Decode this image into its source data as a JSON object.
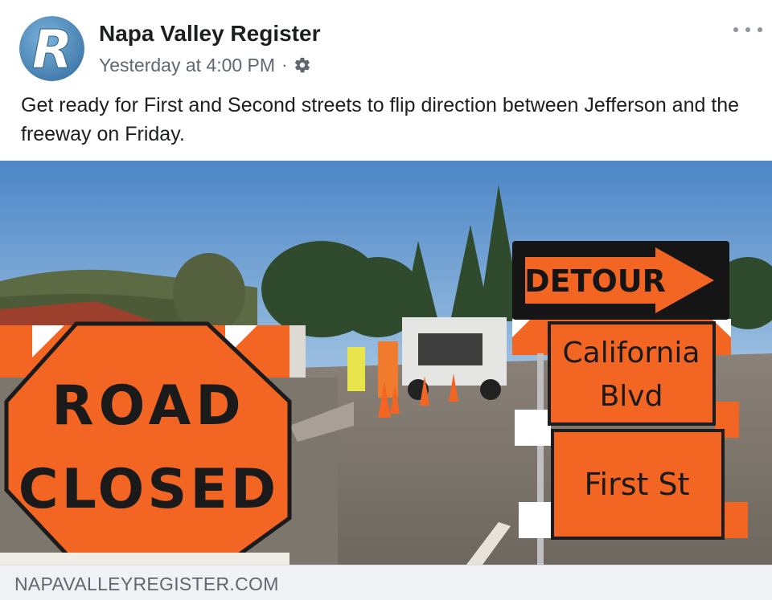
{
  "post": {
    "page_name": "Napa Valley Register",
    "timestamp": "Yesterday at 4:00 PM",
    "separator": "·",
    "privacy_icon": "gear-icon",
    "more_icon": "more-options-icon",
    "text": "Get ready for First and Second streets to flip direction between Jefferson and the freeway on Friday."
  },
  "avatar": {
    "logo_letter": "R",
    "bg_color": "#4f8fbf"
  },
  "photo": {
    "road_sign_line1": "ROAD",
    "road_sign_line2": "CLOSED",
    "detour_text": "DETOUR",
    "sign_california_line1": "California",
    "sign_california_line2": "Blvd",
    "sign_first": "First St",
    "sign_color": "#f26522"
  },
  "link": {
    "domain": "NAPAVALLEYREGISTER.COM"
  }
}
